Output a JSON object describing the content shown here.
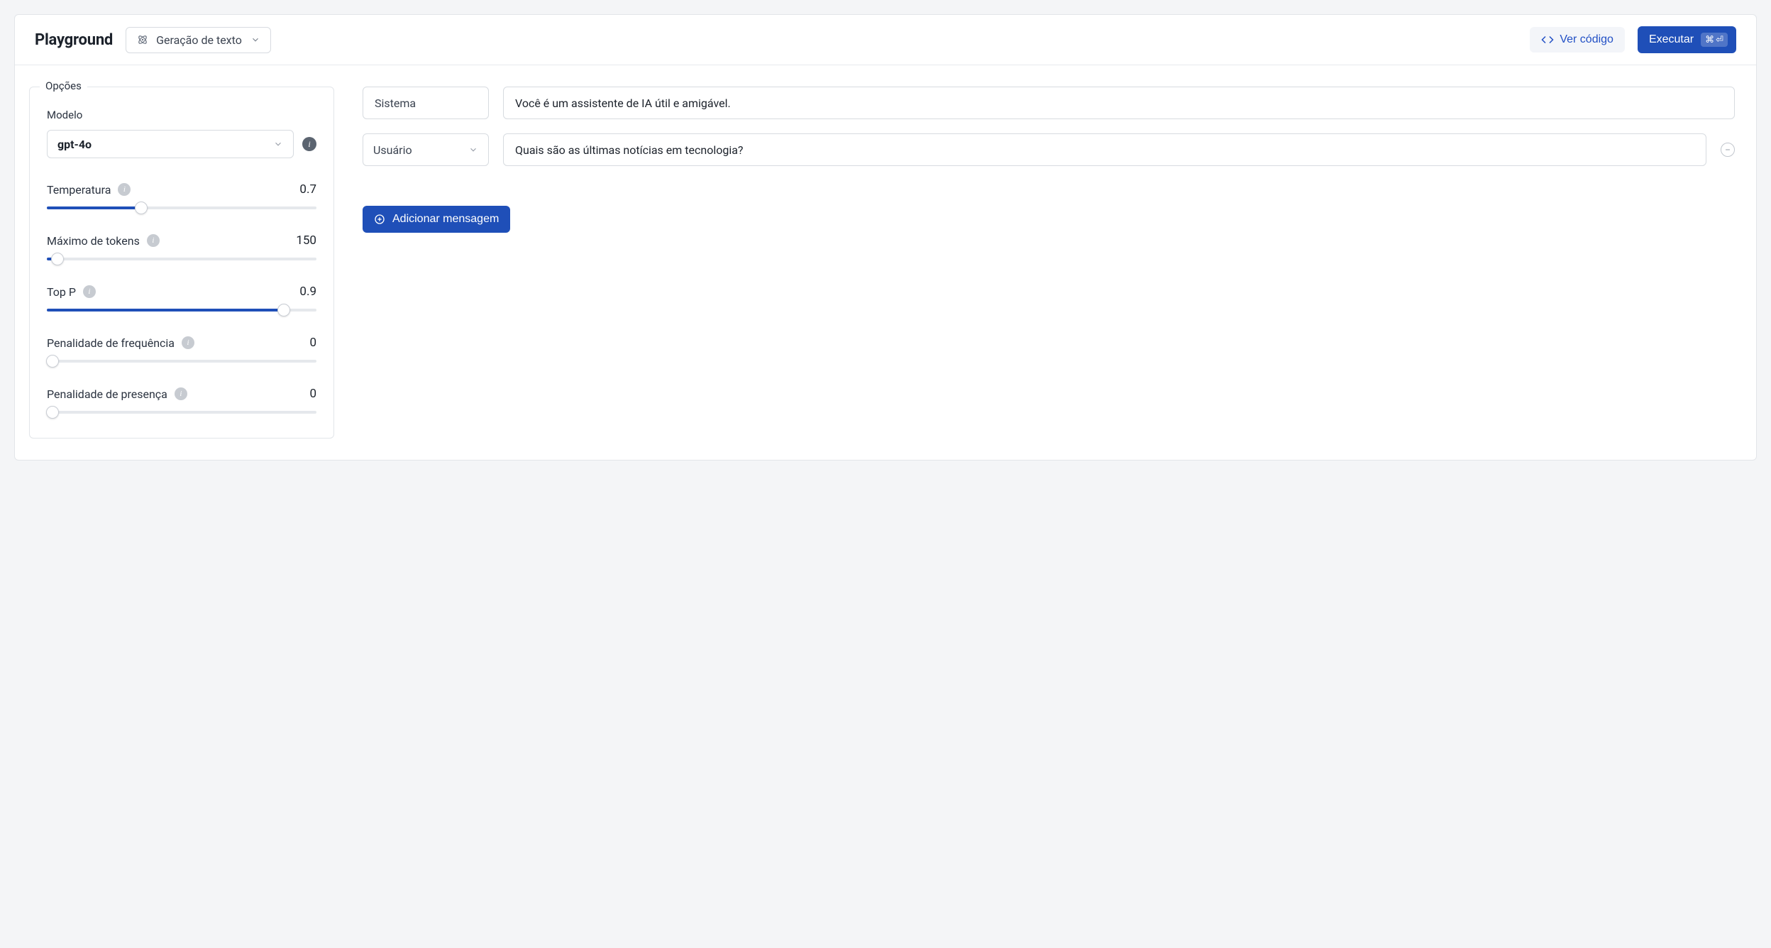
{
  "header": {
    "title": "Playground",
    "mode_label": "Geração de texto",
    "view_code_label": "Ver código",
    "run_label": "Executar",
    "run_shortcut": "⌘ ⏎"
  },
  "options": {
    "legend": "Opções",
    "model_label": "Modelo",
    "model_value": "gpt-4o",
    "sliders": [
      {
        "label": "Temperatura",
        "value": "0.7",
        "percent": 35
      },
      {
        "label": "Máximo de tokens",
        "value": "150",
        "percent": 4
      },
      {
        "label": "Top P",
        "value": "0.9",
        "percent": 88
      },
      {
        "label": "Penalidade de frequência",
        "value": "0",
        "percent": 0
      },
      {
        "label": "Penalidade de presença",
        "value": "0",
        "percent": 0
      }
    ]
  },
  "messages": {
    "rows": [
      {
        "role": "Sistema",
        "role_fixed": true,
        "content": "Você é um assistente de IA útil e amigável.",
        "removable": false
      },
      {
        "role": "Usuário",
        "role_fixed": false,
        "content": "Quais são as últimas notícias em tecnologia?",
        "removable": true
      }
    ],
    "add_label": "Adicionar mensagem"
  }
}
